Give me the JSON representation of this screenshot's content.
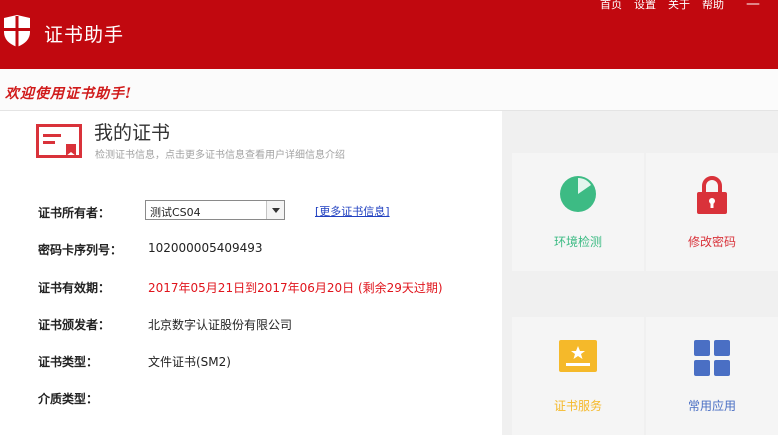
{
  "header": {
    "app_title": "证书助手",
    "nav": [
      "首页",
      "设置",
      "关于",
      "帮助"
    ],
    "minimize": "—",
    "bg_color": "#c1080f"
  },
  "welcome": {
    "text": "欢迎使用证书助手!"
  },
  "cert_panel": {
    "title": "我的证书",
    "subtitle": "检测证书信息，点击更多证书信息查看用户详细信息介绍",
    "owner": {
      "label": "证书所有者：",
      "value": "测试CS04",
      "more_link": "[更多证书信息]"
    },
    "serial": {
      "label": "密码卡序列号：",
      "value": "102000005409493"
    },
    "validity": {
      "label": "证书有效期：",
      "value": "2017年05月21日到2017年06月20日 (剩余29天过期)"
    },
    "issuer": {
      "label": "证书颁发者：",
      "value": "北京数字认证股份有限公司"
    },
    "cert_type": {
      "label": "证书类型：",
      "value": "文件证书(SM2)"
    },
    "media_type": {
      "label": "介质类型：",
      "value": ""
    }
  },
  "tiles": {
    "env_check": {
      "label": "环境检测",
      "color": "#3dbb84",
      "icon": "pie-chart-icon"
    },
    "change_password": {
      "label": "修改密码",
      "color": "#d9323a",
      "icon": "lock-icon"
    },
    "cert_service": {
      "label": "证书服务",
      "color": "#f5b92a",
      "icon": "certificate-icon"
    },
    "common_apps": {
      "label": "常用应用",
      "color": "#4a6fc4",
      "icon": "grid-icon"
    }
  }
}
